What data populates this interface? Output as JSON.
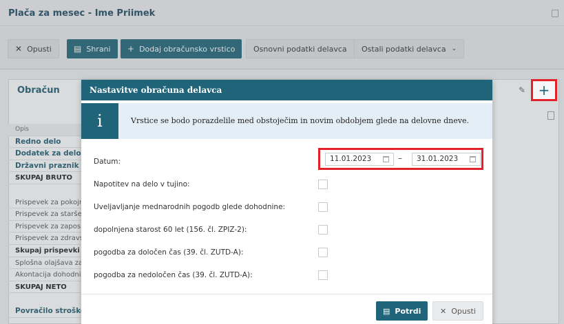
{
  "page": {
    "title": "Plača za mesec - Ime Priimek"
  },
  "toolbar": {
    "cancel_label": "Opusti",
    "save_label": "Shrani",
    "add_row_label": "Dodaj obračunsko vrstico",
    "employee_basic_label": "Osnovni podatki delavca",
    "employee_other_label": "Ostali podatki delavca"
  },
  "card": {
    "title": "Obračun"
  },
  "rows": [
    "Opis",
    "Redno delo",
    "Dodatek za delovno",
    "Državni praznik",
    "SKUPAJ BRUTO",
    "",
    "Prispevek za pokojn",
    "Prispevek za starše",
    "Prispevek za zaposl",
    "Prispevek za zdravs",
    "Skupaj prispevki iz",
    "Splošna olajšava za",
    "Akontacija dohodni",
    "SKUPAJ NETO",
    "",
    "Povračilo stroškov"
  ],
  "modal": {
    "title": "Nastavitve obračuna delavca",
    "info_icon": "i",
    "info_text": "Vrstice se bodo porazdelile med obstoječim in novim obdobjem glede na delovne dneve.",
    "date_label": "Datum:",
    "date_from": "11.01.2023",
    "date_separator": "–",
    "date_to": "31.01.2023",
    "options": [
      "Napotitev na delo v tujino:",
      "Uveljavljanje mednarodnih pogodb glede dohodnine:",
      "dopolnjena starost 60 let (156. čl. ZPIZ-2):",
      "pogodba za določen čas (39. čl. ZUTD-A):",
      "pogodba za nedoločen čas (39. čl. ZUTD-A):"
    ],
    "confirm_label": "Potrdi",
    "cancel_label": "Opusti"
  }
}
